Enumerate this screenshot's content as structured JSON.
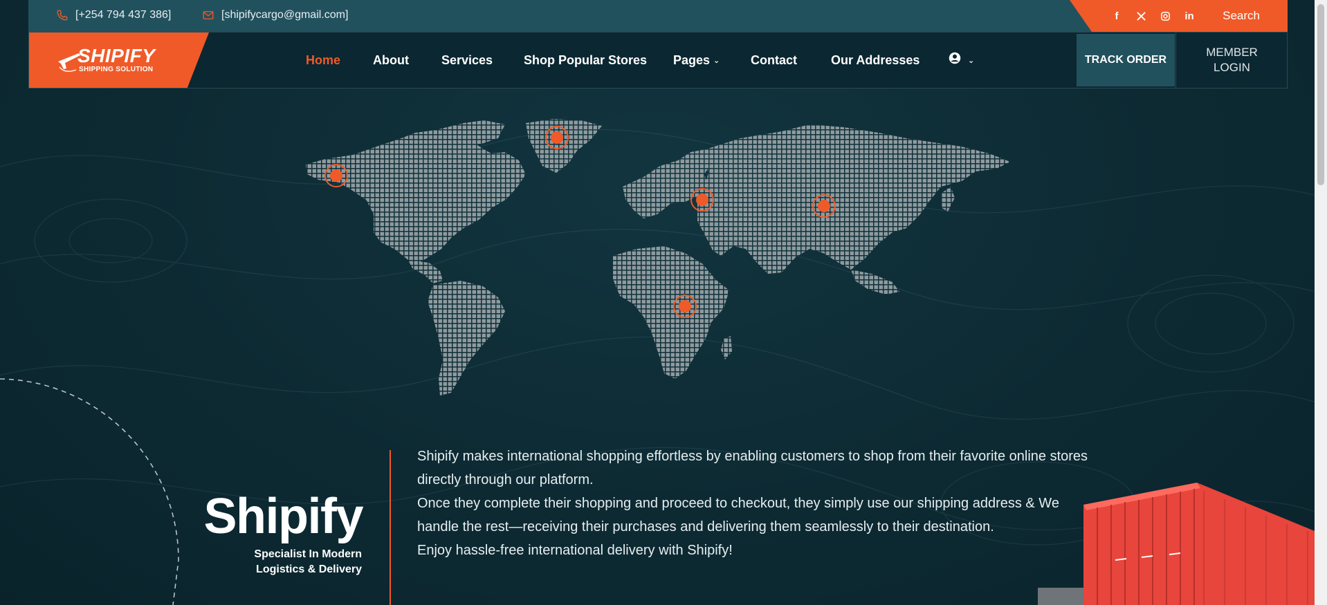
{
  "topbar": {
    "phone": "[+254 794 437 386]",
    "email": "[shipifycargo@gmail.com]",
    "search_label": "Search",
    "social": [
      "facebook-icon",
      "x-twitter-icon",
      "instagram-icon",
      "linkedin-icon"
    ]
  },
  "logo": {
    "name": "SHIPIFY",
    "tagline": "SHIPPING SOLUTION"
  },
  "nav": {
    "items": [
      {
        "label": "Home",
        "active": true
      },
      {
        "label": "About"
      },
      {
        "label": "Services"
      },
      {
        "label": "Shop Popular Stores"
      },
      {
        "label": "Pages",
        "dropdown": true
      },
      {
        "label": "Contact"
      },
      {
        "label": "Our Addresses"
      }
    ],
    "account_icon": "user-circle-icon",
    "track_order": "TRACK ORDER",
    "member_login_1": "MEMBER",
    "member_login_2": "LOGIN"
  },
  "hero": {
    "title": "Shipify",
    "subtitle_1": "Specialist In Modern",
    "subtitle_2": "Logistics & Delivery",
    "paragraphs": [
      "Shipify makes international shopping effortless by enabling customers to shop from their favorite online stores directly through our platform.",
      "Once they complete their shopping and proceed to checkout, they simply use our shipping address & We handle the rest—receiving their purchases and delivering them seamlessly to their destination.",
      "Enjoy hassle-free international delivery with Shipify!"
    ]
  },
  "colors": {
    "accent": "#f05a28",
    "background": "#0d2a33",
    "topbar": "#22515e",
    "map_dots": "#8e9a9e"
  }
}
